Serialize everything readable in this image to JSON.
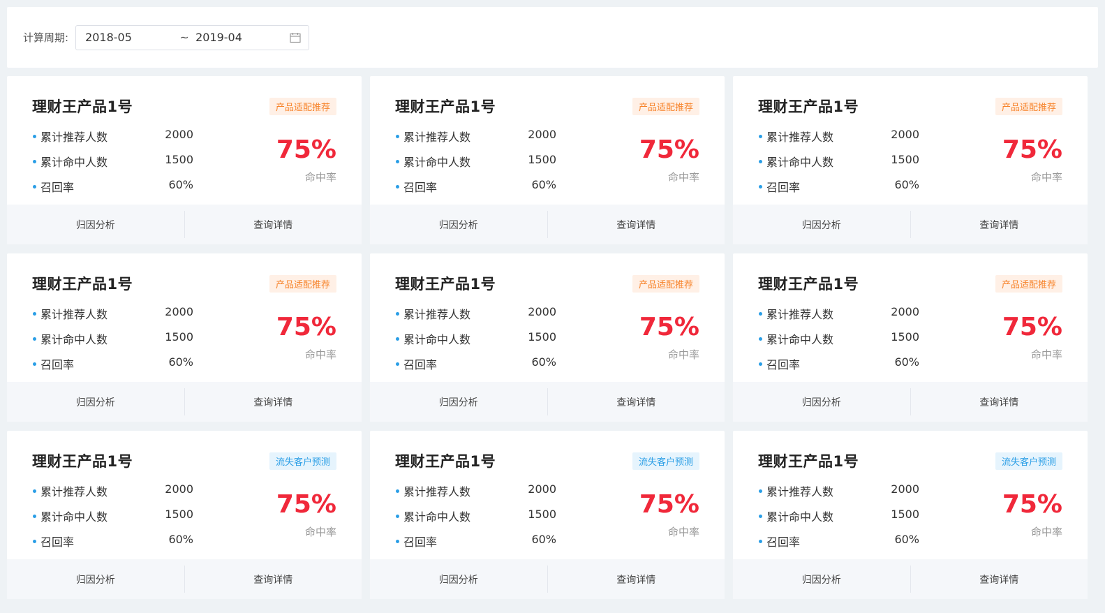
{
  "filter": {
    "label": "计算周期:",
    "start": "2018-05",
    "separator": "~",
    "end": "2019-04",
    "icon": "calendar-icon"
  },
  "cards": [
    {
      "title": "理财王产品1号",
      "tag": "产品适配推荐",
      "tag_color": "#f7832a",
      "metrics": [
        {
          "label": "累计推荐人数",
          "value": "2000"
        },
        {
          "label": "累计命中人数",
          "value": "1500"
        },
        {
          "label": "召回率",
          "value": "60%"
        }
      ],
      "rate": "75%",
      "rate_label": "命中率",
      "actions": [
        "归因分析",
        "查询详情"
      ]
    },
    {
      "title": "理财王产品1号",
      "tag": "产品适配推荐",
      "tag_color": "#f7832a",
      "metrics": [
        {
          "label": "累计推荐人数",
          "value": "2000"
        },
        {
          "label": "累计命中人数",
          "value": "1500"
        },
        {
          "label": "召回率",
          "value": "60%"
        }
      ],
      "rate": "75%",
      "rate_label": "命中率",
      "actions": [
        "归因分析",
        "查询详情"
      ]
    },
    {
      "title": "理财王产品1号",
      "tag": "产品适配推荐",
      "tag_color": "#f7832a",
      "metrics": [
        {
          "label": "累计推荐人数",
          "value": "2000"
        },
        {
          "label": "累计命中人数",
          "value": "1500"
        },
        {
          "label": "召回率",
          "value": "60%"
        }
      ],
      "rate": "75%",
      "rate_label": "命中率",
      "actions": [
        "归因分析",
        "查询详情"
      ]
    },
    {
      "title": "理财王产品1号",
      "tag": "产品适配推荐",
      "tag_color": "#f7832a",
      "metrics": [
        {
          "label": "累计推荐人数",
          "value": "2000"
        },
        {
          "label": "累计命中人数",
          "value": "1500"
        },
        {
          "label": "召回率",
          "value": "60%"
        }
      ],
      "rate": "75%",
      "rate_label": "命中率",
      "actions": [
        "归因分析",
        "查询详情"
      ]
    },
    {
      "title": "理财王产品1号",
      "tag": "产品适配推荐",
      "tag_color": "#f7832a",
      "metrics": [
        {
          "label": "累计推荐人数",
          "value": "2000"
        },
        {
          "label": "累计命中人数",
          "value": "1500"
        },
        {
          "label": "召回率",
          "value": "60%"
        }
      ],
      "rate": "75%",
      "rate_label": "命中率",
      "actions": [
        "归因分析",
        "查询详情"
      ]
    },
    {
      "title": "理财王产品1号",
      "tag": "产品适配推荐",
      "tag_color": "#f7832a",
      "metrics": [
        {
          "label": "累计推荐人数",
          "value": "2000"
        },
        {
          "label": "累计命中人数",
          "value": "1500"
        },
        {
          "label": "召回率",
          "value": "60%"
        }
      ],
      "rate": "75%",
      "rate_label": "命中率",
      "actions": [
        "归因分析",
        "查询详情"
      ]
    },
    {
      "title": "理财王产品1号",
      "tag": "流失客户预测",
      "tag_color": "#2a9ee6",
      "metrics": [
        {
          "label": "累计推荐人数",
          "value": "2000"
        },
        {
          "label": "累计命中人数",
          "value": "1500"
        },
        {
          "label": "召回率",
          "value": "60%"
        }
      ],
      "rate": "75%",
      "rate_label": "命中率",
      "actions": [
        "归因分析",
        "查询详情"
      ]
    },
    {
      "title": "理财王产品1号",
      "tag": "流失客户预测",
      "tag_color": "#2a9ee6",
      "metrics": [
        {
          "label": "累计推荐人数",
          "value": "2000"
        },
        {
          "label": "累计命中人数",
          "value": "1500"
        },
        {
          "label": "召回率",
          "value": "60%"
        }
      ],
      "rate": "75%",
      "rate_label": "命中率",
      "actions": [
        "归因分析",
        "查询详情"
      ]
    },
    {
      "title": "理财王产品1号",
      "tag": "流失客户预测",
      "tag_color": "#2a9ee6",
      "metrics": [
        {
          "label": "累计推荐人数",
          "value": "2000"
        },
        {
          "label": "累计命中人数",
          "value": "1500"
        },
        {
          "label": "召回率",
          "value": "60%"
        }
      ],
      "rate": "75%",
      "rate_label": "命中率",
      "actions": [
        "归因分析",
        "查询详情"
      ]
    }
  ],
  "colors": {
    "rate": "#f0283a",
    "bullet": "#2a9ee6",
    "background": "#eef2f5"
  }
}
